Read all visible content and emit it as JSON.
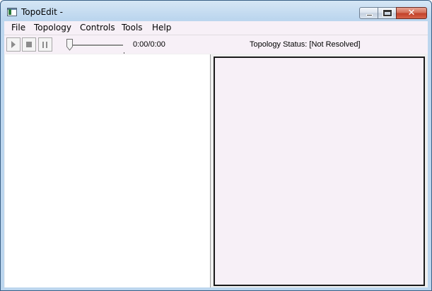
{
  "window": {
    "title": "TopoEdit -",
    "caption_buttons": [
      "minimize",
      "maximize",
      "close"
    ]
  },
  "menu": {
    "items": [
      {
        "label": "File"
      },
      {
        "label": "Topology"
      },
      {
        "label": "Controls"
      },
      {
        "label": "Tools"
      },
      {
        "label": "Help"
      }
    ]
  },
  "toolbar": {
    "play_icon": "play-icon",
    "stop_icon": "stop-icon",
    "pause_icon": "pause-icon",
    "seek_position": 0.0,
    "time": "0:00/0:00",
    "status": "Topology Status: [Not Resolved]"
  },
  "colors": {
    "menu_background": "#f7f0f7",
    "right_pane_background": "#f7f0f7",
    "left_pane_background": "#ffffff",
    "close_button": "#c2422a"
  }
}
